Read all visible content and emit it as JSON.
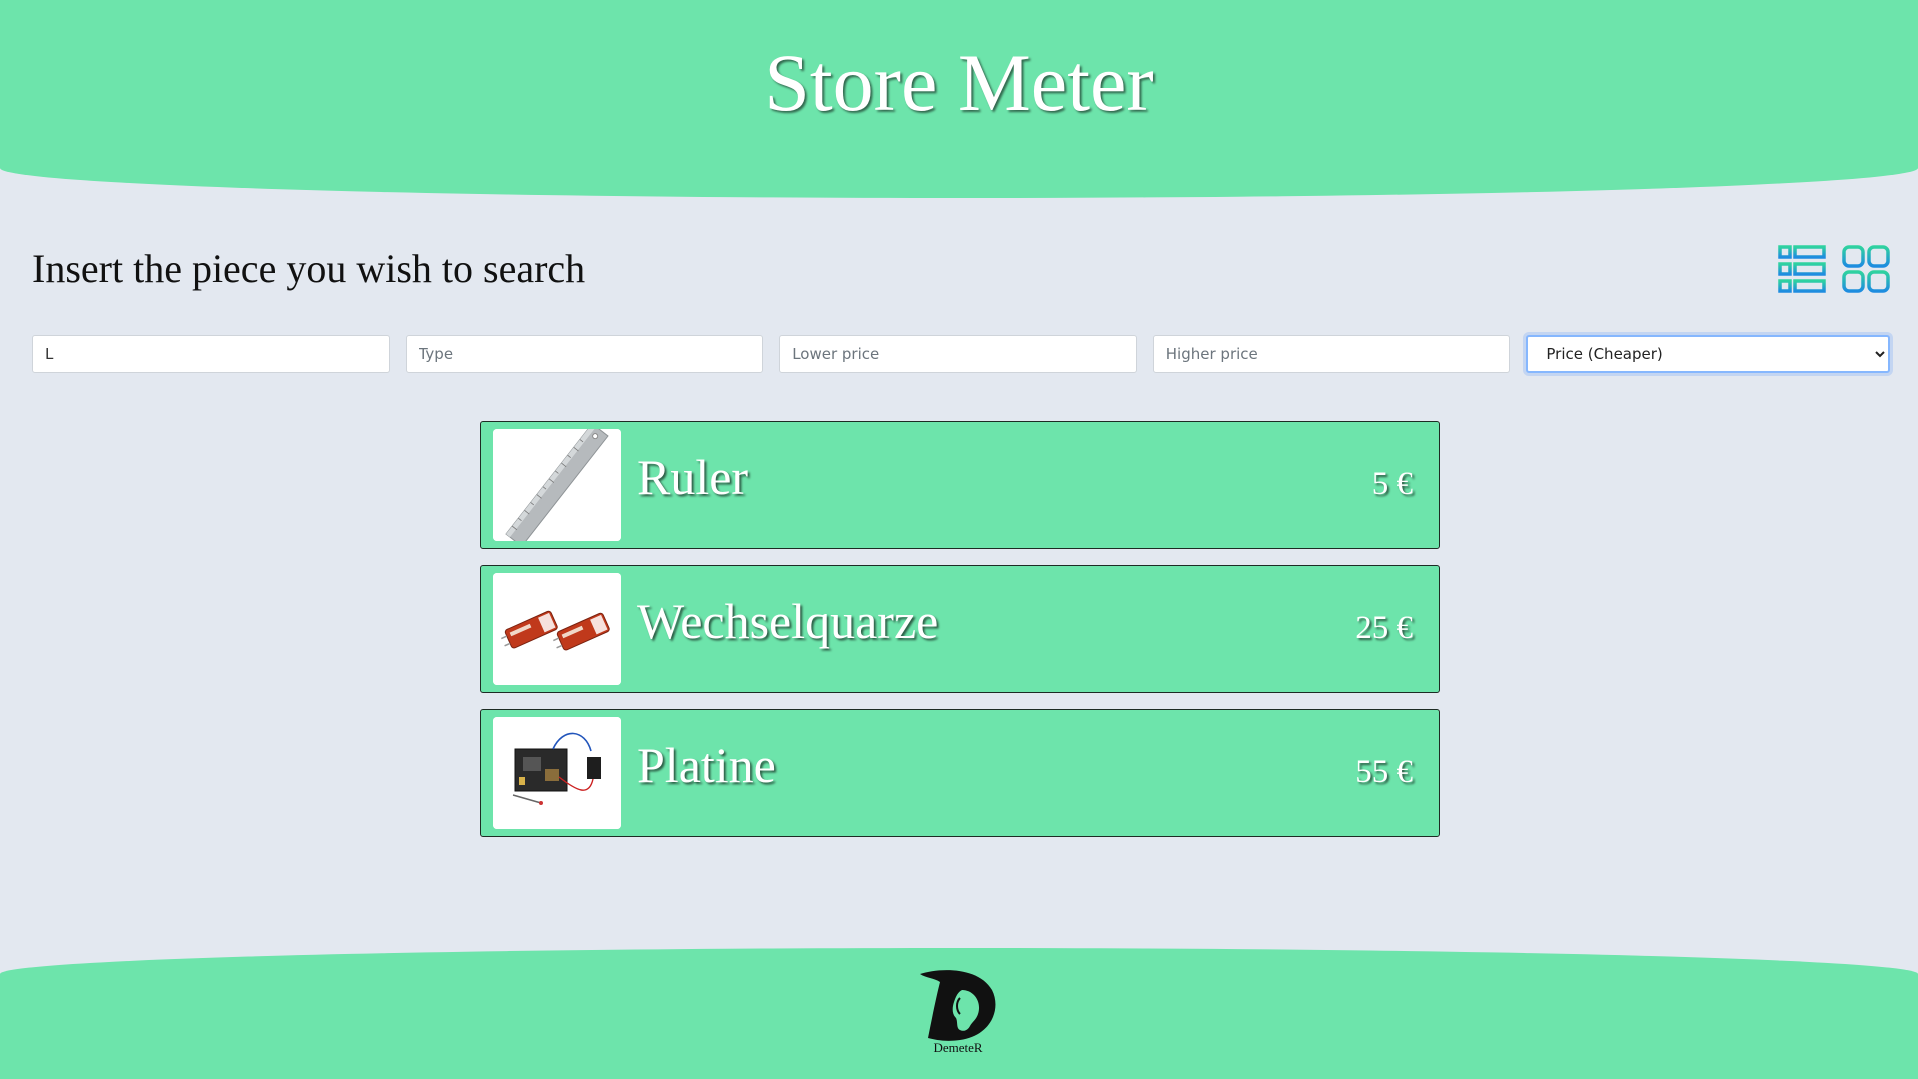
{
  "header": {
    "title": "Store Meter"
  },
  "search": {
    "heading": "Insert the piece you wish to search",
    "name_value": "L",
    "type_placeholder": "Type",
    "lower_price_placeholder": "Lower price",
    "higher_price_placeholder": "Higher price",
    "sort_selected": "Price (Cheaper)"
  },
  "view_toggles": {
    "active": "list-view",
    "icons": [
      "list-view-icon",
      "grid-view-icon"
    ]
  },
  "products": [
    {
      "name": "Ruler",
      "price": "5 €",
      "image": "ruler-image"
    },
    {
      "name": "Wechselquarze",
      "price": "25 €",
      "image": "crystal-oscillator-image"
    },
    {
      "name": "Platine",
      "price": "55 €",
      "image": "circuit-board-image"
    }
  ],
  "footer": {
    "logo_text": "DemeteR"
  },
  "colors": {
    "brand_green": "#6de4ab",
    "background": "#e3e8f0",
    "icon_gradient_start": "#2fd2a0",
    "icon_gradient_end": "#1e8ce0"
  }
}
